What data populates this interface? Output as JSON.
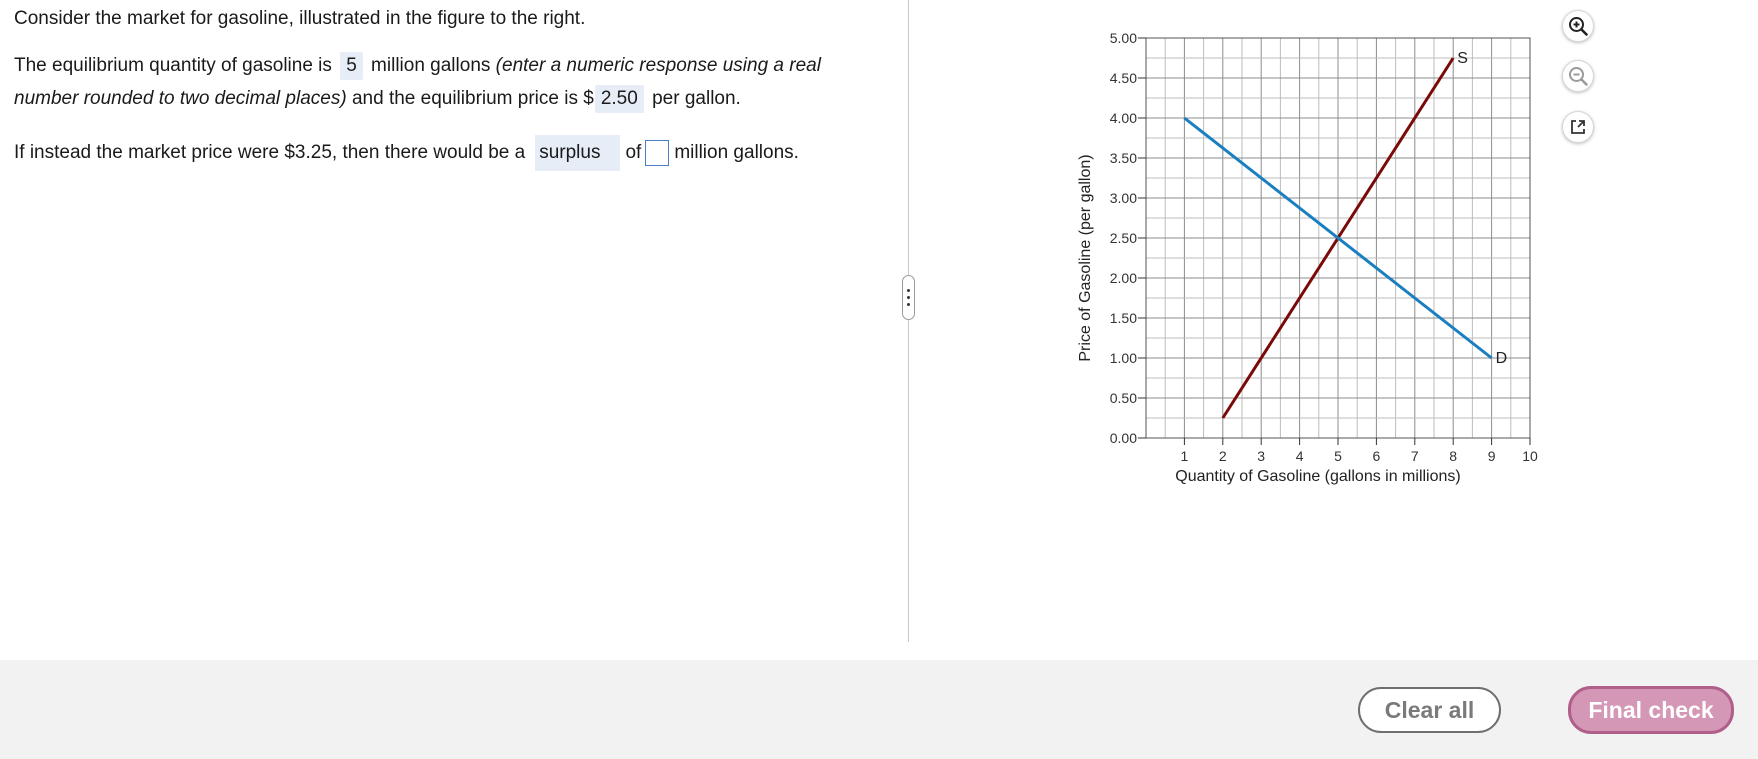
{
  "question": {
    "intro": "Consider the market for gasoline, illustrated in the figure to the right.",
    "eq_part1": "The equilibrium quantity of gasoline is",
    "eq_quantity_answer": "5",
    "eq_part2": "million gallons",
    "eq_instruction_a": "(enter a numeric response using a real",
    "eq_instruction_b": "number rounded to two decimal places)",
    "eq_part3": "and the equilibrium price is $",
    "eq_price_answer": "2.50",
    "eq_part4": "per gallon.",
    "surplus_part1": "If instead the market price were $3.25, then there would be a",
    "surplus_dropdown_value": "surplus",
    "surplus_part2": "of",
    "surplus_input_value": "",
    "surplus_part3": "million gallons."
  },
  "chart_data": {
    "type": "line",
    "xlabel": "Quantity of Gasoline (gallons in millions)",
    "ylabel": "Price of Gasoline (per gallon)",
    "xlim": [
      0,
      10
    ],
    "ylim": [
      0,
      5
    ],
    "x_ticks": [
      1,
      2,
      3,
      4,
      5,
      6,
      7,
      8,
      9,
      10
    ],
    "y_ticks": [
      "0.00",
      "0.50",
      "1.00",
      "1.50",
      "2.00",
      "2.50",
      "3.00",
      "3.50",
      "4.00",
      "4.50",
      "5.00"
    ],
    "grid": true,
    "series": [
      {
        "name": "S",
        "color": "#7a0a0a",
        "x": [
          2,
          8
        ],
        "y": [
          0.25,
          4.75
        ]
      },
      {
        "name": "D",
        "color": "#1a7fc0",
        "x": [
          1,
          9
        ],
        "y": [
          4.0,
          1.0
        ]
      }
    ]
  },
  "tools": {
    "zoom_in_icon": "zoom-in-icon",
    "zoom_out_icon": "zoom-out-icon",
    "popout_icon": "external-link-icon"
  },
  "footer": {
    "clear_all_label": "Clear all",
    "final_check_label": "Final check"
  },
  "colors": {
    "supply": "#7a0a0a",
    "demand": "#1a7fc0",
    "final_check_bg": "#d497b5",
    "answer_bg": "#e6edf6"
  }
}
